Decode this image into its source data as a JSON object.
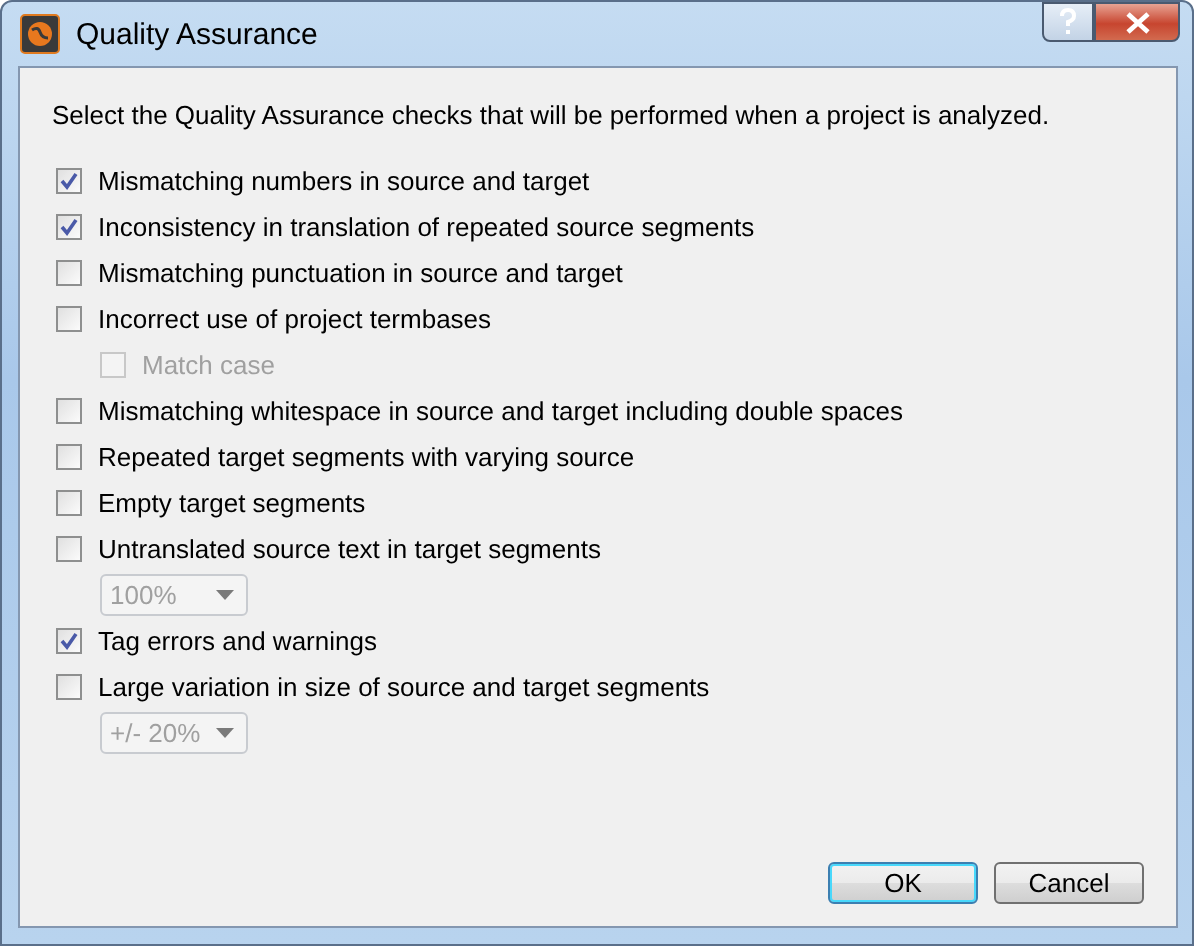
{
  "window": {
    "title": "Quality Assurance"
  },
  "instruction": "Select the Quality Assurance checks that will be performed when a project is analyzed.",
  "options": [
    {
      "kind": "checkbox",
      "label": "Mismatching numbers in source and target",
      "checked": true,
      "disabled": false
    },
    {
      "kind": "checkbox",
      "label": "Inconsistency in translation of repeated source segments",
      "checked": true,
      "disabled": false
    },
    {
      "kind": "checkbox",
      "label": "Mismatching punctuation in source and target",
      "checked": false,
      "disabled": false
    },
    {
      "kind": "checkbox",
      "label": "Incorrect use of project termbases",
      "checked": false,
      "disabled": false,
      "children": [
        {
          "kind": "checkbox",
          "label": "Match case",
          "checked": false,
          "disabled": true
        }
      ]
    },
    {
      "kind": "checkbox",
      "label": "Mismatching whitespace in source and target including double spaces",
      "checked": false,
      "disabled": false
    },
    {
      "kind": "checkbox",
      "label": "Repeated target segments with varying source",
      "checked": false,
      "disabled": false
    },
    {
      "kind": "checkbox",
      "label": "Empty target segments",
      "checked": false,
      "disabled": false
    },
    {
      "kind": "checkbox",
      "label": "Untranslated source text in target segments",
      "checked": false,
      "disabled": false,
      "children": [
        {
          "kind": "dropdown",
          "value": "100%",
          "disabled": true
        }
      ]
    },
    {
      "kind": "checkbox",
      "label": "Tag errors and warnings",
      "checked": true,
      "disabled": false
    },
    {
      "kind": "checkbox",
      "label": "Large variation in size of source and target segments",
      "checked": false,
      "disabled": false,
      "children": [
        {
          "kind": "dropdown",
          "value": "+/- 20%",
          "disabled": true
        }
      ]
    }
  ],
  "buttons": [
    {
      "label": "OK",
      "default": true
    },
    {
      "label": "Cancel",
      "default": false
    }
  ]
}
